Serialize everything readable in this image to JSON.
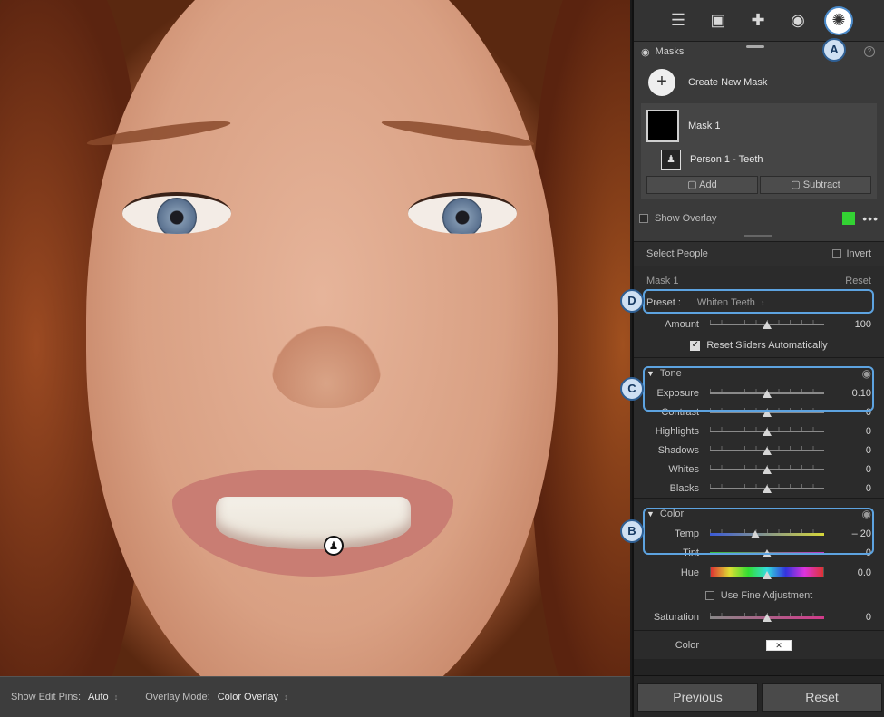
{
  "toolbar": {
    "show_edit_pins_label": "Show Edit Pins:",
    "show_edit_pins_value": "Auto",
    "overlay_mode_label": "Overlay Mode:",
    "overlay_mode_value": "Color Overlay"
  },
  "tools": {
    "icons": [
      "sliders-icon",
      "crop-icon",
      "healing-icon",
      "red-eye-icon",
      "masking-icon"
    ],
    "active": "masking-icon"
  },
  "masks": {
    "title": "Masks",
    "help": "?",
    "create_label": "Create New Mask",
    "mask_name": "Mask 1",
    "component_name": "Person 1 - Teeth",
    "add_label": "Add",
    "subtract_label": "Subtract",
    "show_overlay_label": "Show Overlay",
    "overlay_color": "#33d233",
    "more": "•••"
  },
  "select_people": {
    "label": "Select People",
    "invert_label": "Invert"
  },
  "mask_section": {
    "title": "Mask 1",
    "reset_label": "Reset",
    "preset_label": "Preset :",
    "preset_value": "Whiten Teeth",
    "amount_label": "Amount",
    "amount_value": "100",
    "reset_sliders_label": "Reset Sliders Automatically"
  },
  "tone": {
    "title": "Tone",
    "sliders": [
      {
        "label": "Exposure",
        "value": "0.10",
        "pos": 0.5
      },
      {
        "label": "Contrast",
        "value": "0",
        "pos": 0.5
      },
      {
        "label": "Highlights",
        "value": "0",
        "pos": 0.5
      },
      {
        "label": "Shadows",
        "value": "0",
        "pos": 0.5
      },
      {
        "label": "Whites",
        "value": "0",
        "pos": 0.5
      },
      {
        "label": "Blacks",
        "value": "0",
        "pos": 0.5
      }
    ]
  },
  "color": {
    "title": "Color",
    "temp_label": "Temp",
    "temp_value": "– 20",
    "temp_pos": 0.4,
    "tint_label": "Tint",
    "tint_value": "0",
    "hue_label": "Hue",
    "hue_value": "0.0",
    "fine_adjust_label": "Use Fine Adjustment",
    "saturation_label": "Saturation",
    "saturation_value": "0",
    "color_label": "Color"
  },
  "callouts": {
    "a": "A",
    "b": "B",
    "c": "C",
    "d": "D"
  },
  "buttons": {
    "previous": "Previous",
    "reset": "Reset"
  }
}
